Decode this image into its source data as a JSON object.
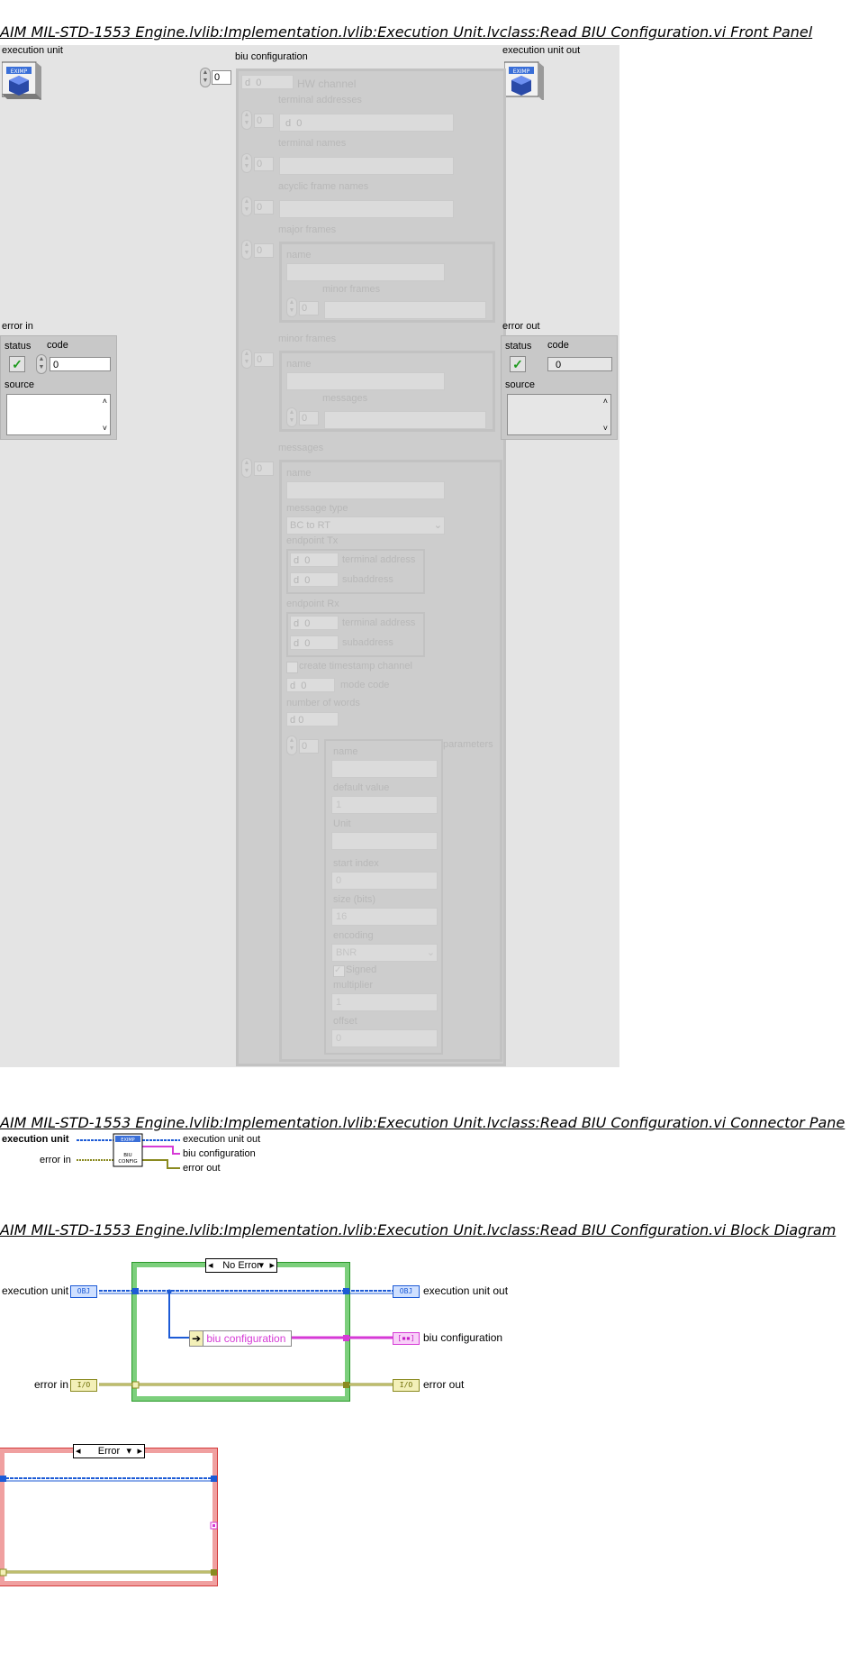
{
  "front_panel": {
    "title": "AIM MIL-STD-1553 Engine.lvlib:Implementation.lvlib:Execution Unit.lvclass:Read BIU Configuration.vi Front Panel",
    "execution_unit_label": "execution unit",
    "execution_unit_out_label": "execution unit out",
    "object_icon_text": "EXIMP",
    "biu_configuration": {
      "label": "biu configuration",
      "index": "0",
      "hw_channel_label": "HW channel",
      "hw_channel_value": "0",
      "radix": "d",
      "terminal_addresses_label": "terminal addresses",
      "terminal_addresses_index": "0",
      "terminal_addresses_value": "0",
      "terminal_names_label": "terminal names",
      "terminal_names_index": "0",
      "acyclic_frame_names_label": "acyclic frame names",
      "acyclic_frame_names_index": "0",
      "major_frames_label": "major frames",
      "major_frames_index": "0",
      "major_name_label": "name",
      "major_minor_frames_label": "minor frames",
      "major_minor_frames_index": "0",
      "minor_frames_label": "minor frames",
      "minor_frames_index": "0",
      "minor_name_label": "name",
      "minor_messages_label": "messages",
      "minor_messages_index": "0",
      "messages_label": "messages",
      "messages_index": "0",
      "msg_name_label": "name",
      "message_type_label": "message type",
      "message_type_value": "BC to RT",
      "endpoint_tx_label": "endpoint Tx",
      "endpoint_rx_label": "endpoint Rx",
      "terminal_address_label": "terminal address",
      "subaddress_label": "subaddress",
      "endpoint_value": "0",
      "create_timestamp_label": "create timestamp channel",
      "mode_code_label": "mode code",
      "mode_code_value": "0",
      "number_of_words_label": "number of words",
      "number_of_words_value": "0",
      "parameters_label": "parameters",
      "parameters_index": "0",
      "param_name_label": "name",
      "default_value_label": "default value",
      "default_value_value": "1",
      "unit_label": "Unit",
      "start_index_label": "start index",
      "start_index_value": "0",
      "size_label": "size (bits)",
      "size_value": "16",
      "encoding_label": "encoding",
      "encoding_value": "BNR",
      "signed_label": "Signed",
      "multiplier_label": "multiplier",
      "multiplier_value": "1",
      "offset_label": "offset",
      "offset_value": "0"
    },
    "error_in": {
      "label": "error in",
      "status_label": "status",
      "code_label": "code",
      "code_value": "0",
      "source_label": "source"
    },
    "error_out": {
      "label": "error out",
      "status_label": "status",
      "code_label": "code",
      "code_value": "0",
      "source_label": "source"
    }
  },
  "connector_pane": {
    "title": "AIM MIL-STD-1553 Engine.lvlib:Implementation.lvlib:Execution Unit.lvclass:Read BIU Configuration.vi Connector Pane",
    "execution_unit": "execution unit",
    "error_in": "error in",
    "execution_unit_out": "execution unit out",
    "biu_configuration": "biu configuration",
    "error_out": "error out",
    "icon_top": "EXIMP",
    "icon_bottom": "BIU CONFIG"
  },
  "block_diagram": {
    "title": "AIM MIL-STD-1553 Engine.lvlib:Implementation.lvlib:Execution Unit.lvclass:Read BIU Configuration.vi Block Diagram",
    "case_no_error": "No Error",
    "case_error": "Error",
    "execution_unit": "execution unit",
    "execution_unit_out": "execution unit out",
    "bundle_label": "biu configuration",
    "biu_configuration": "biu configuration",
    "error_in": "error in",
    "error_out": "error out",
    "obj_terminal_text": "OBJ",
    "err_terminal_text": "I/O",
    "colors": {
      "object_wire": "#1d5bd6",
      "cluster_wire": "#d63ad6",
      "error_wire": "#8a8a20",
      "no_error_frame": "#2a9a2a",
      "error_frame": "#d43a3a"
    }
  }
}
